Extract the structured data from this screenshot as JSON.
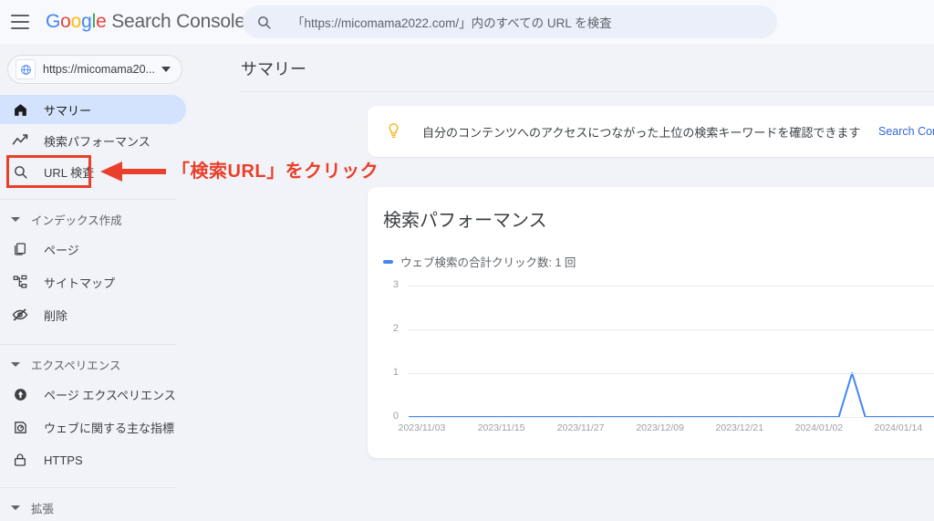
{
  "topbar": {
    "menu_icon": "hamburger-icon",
    "brand_google": "Google",
    "brand_product": "Search Console",
    "search": {
      "icon": "search-icon",
      "placeholder": "「https://micomama2022.com/」内のすべての URL を検査",
      "value": ""
    }
  },
  "property_selector": {
    "icon": "globe-icon",
    "label": "https://micomama20...",
    "caret_icon": "chevron-down-icon"
  },
  "sidebar": {
    "items": [
      {
        "id": "summary",
        "icon": "home-icon",
        "label": "サマリー",
        "active": true
      },
      {
        "id": "performance",
        "icon": "trending-up-icon",
        "label": "検索パフォーマンス",
        "active": false
      },
      {
        "id": "url-inspection",
        "icon": "search-icon",
        "label": "URL 検査",
        "active": false
      }
    ],
    "sections": [
      {
        "id": "indexing",
        "label": "インデックス作成",
        "expanded": true,
        "items": [
          {
            "id": "pages",
            "icon": "pages-icon",
            "label": "ページ"
          },
          {
            "id": "sitemaps",
            "icon": "sitemap-icon",
            "label": "サイトマップ"
          },
          {
            "id": "removals",
            "icon": "eye-off-icon",
            "label": "削除"
          }
        ]
      },
      {
        "id": "experience",
        "label": "エクスペリエンス",
        "expanded": true,
        "items": [
          {
            "id": "page-experience",
            "icon": "page-experience-icon",
            "label": "ページ エクスペリエンス"
          },
          {
            "id": "core-web-vitals",
            "icon": "speedometer-icon",
            "label": "ウェブに関する主な指標"
          },
          {
            "id": "https",
            "icon": "lock-icon",
            "label": "HTTPS"
          }
        ]
      },
      {
        "id": "enhancements",
        "label": "拡張",
        "expanded": true,
        "items": []
      }
    ]
  },
  "main": {
    "page_title": "サマリー",
    "banner": {
      "icon": "lightbulb-icon",
      "text": "自分のコンテンツへのアクセスにつながった上位の検索キーワードを確認できます",
      "link_label": "Search Cons"
    },
    "chart_card": {
      "title": "検索パフォーマンス",
      "legend_label": "ウェブ検索の合計クリック数: 1 回"
    }
  },
  "annotation": {
    "callout_text": "「検索URL」をクリック",
    "color": "#e8402a",
    "target": "url-inspection"
  },
  "colors": {
    "accent_blue": "#4285f4",
    "link_blue": "#3367d6",
    "active_pill": "#d3e3fd",
    "page_bg": "#f1f3f8",
    "card_bg": "#ffffff",
    "annotation_red": "#e8402a",
    "bulb_yellow": "#f9ab00"
  },
  "chart_data": {
    "type": "line",
    "title": "検索パフォーマンス",
    "xlabel": "",
    "ylabel": "",
    "ylim": [
      0,
      3
    ],
    "yticks": [
      0,
      1,
      2,
      3
    ],
    "grid": true,
    "legend_position": "top-left",
    "x_tick_labels": [
      "2023/11/03",
      "2023/11/15",
      "2023/11/27",
      "2023/12/09",
      "2023/12/21",
      "2024/01/02",
      "2024/01/14"
    ],
    "x_domain": [
      "2023/11/01",
      "2024/01/22"
    ],
    "series": [
      {
        "name": "ウェブ検索の合計クリック数: 1 回",
        "color": "#4285f4",
        "total": 1,
        "points": [
          {
            "x": "2023/11/01",
            "y": 0
          },
          {
            "x": "2023/12/21",
            "y": 0
          },
          {
            "x": "2024/01/05",
            "y": 0
          },
          {
            "x": "2024/01/07",
            "y": 1
          },
          {
            "x": "2024/01/09",
            "y": 0
          },
          {
            "x": "2024/01/22",
            "y": 0
          }
        ]
      }
    ]
  }
}
